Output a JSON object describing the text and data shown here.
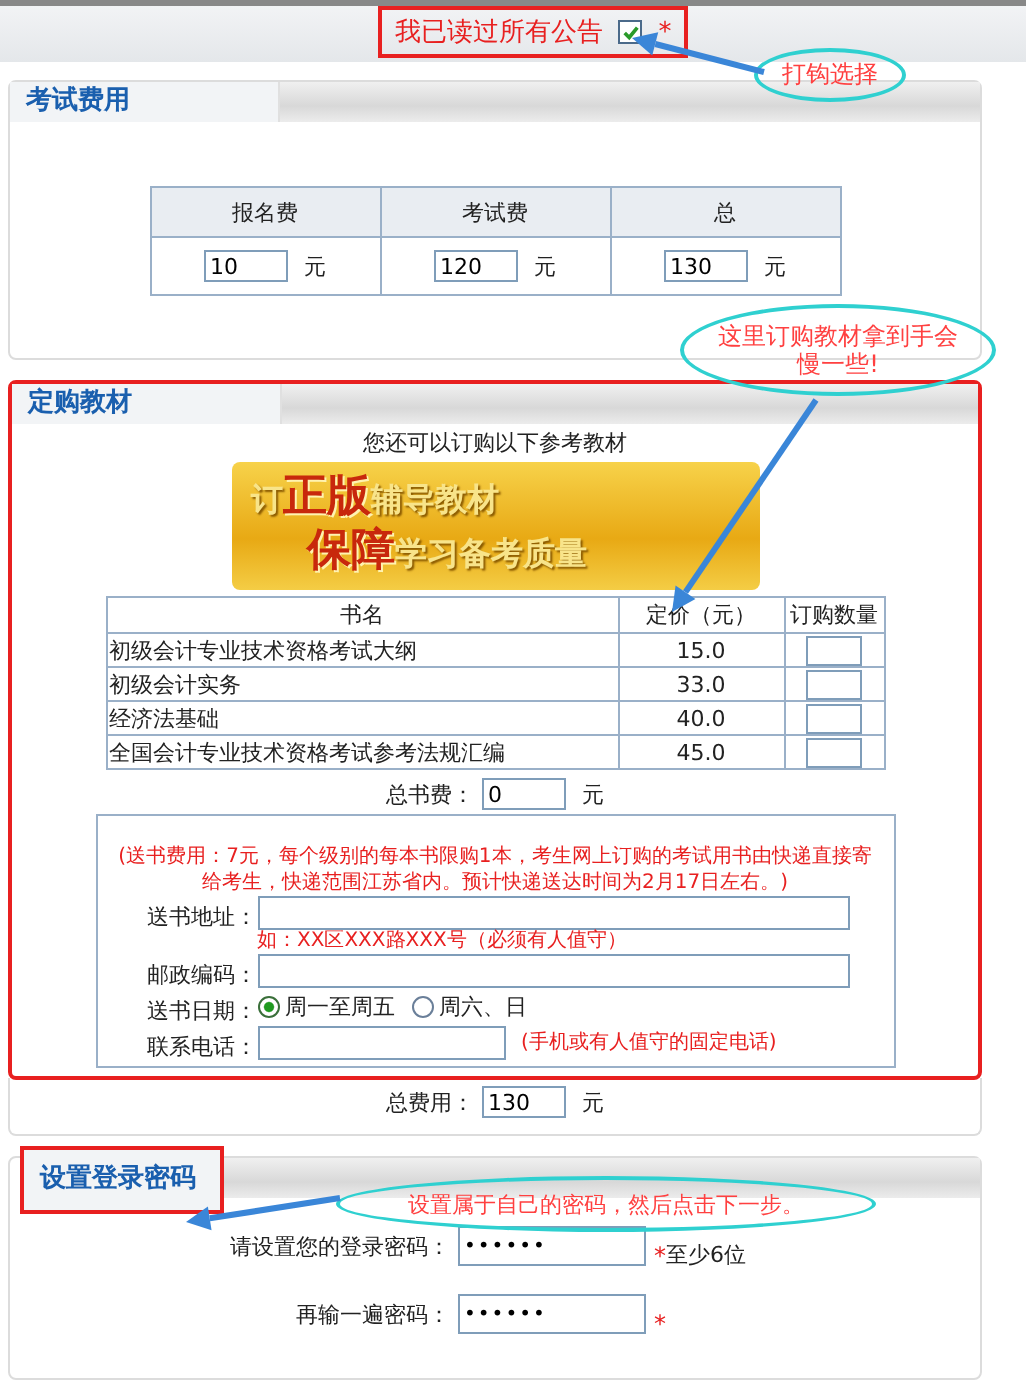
{
  "notice": {
    "text": "我已读过所有公告",
    "checked": true,
    "required_mark": "*"
  },
  "exam_fees": {
    "title": "考试费用",
    "columns": [
      "报名费",
      "考试费",
      "总"
    ],
    "values": [
      {
        "value": "10",
        "unit": "元"
      },
      {
        "value": "120",
        "unit": "元"
      },
      {
        "value": "130",
        "unit": "元"
      }
    ]
  },
  "textbooks": {
    "title": "定购教材",
    "intro": "您还可以订购以下参考教材",
    "banner": [
      [
        {
          "text": "订",
          "emph": false
        },
        {
          "text": "正版",
          "emph": true
        },
        {
          "text": "辅导教材",
          "emph": false
        }
      ],
      [
        {
          "text": "保障",
          "emph": true
        },
        {
          "text": "学习备考质量",
          "emph": false
        }
      ]
    ],
    "columns": [
      "书名",
      "定价（元）",
      "订购数量"
    ],
    "rows": [
      {
        "name": "初级会计专业技术资格考试大纲",
        "price": "15.0"
      },
      {
        "name": "初级会计实务",
        "price": "33.0"
      },
      {
        "name": "经济法基础",
        "price": "40.0"
      },
      {
        "name": "全国会计专业技术资格考试参考法规汇编",
        "price": "45.0"
      }
    ],
    "total": {
      "label": "总书费：",
      "value": "0",
      "unit": "元"
    },
    "shipping": {
      "note": "(送书费用：7元，每个级别的每本书限购1本，考生网上订购的考试用书由快递直接寄给考生，快递范围江苏省内。预计快递送达时间为2月17日左右。)",
      "fields": [
        {
          "kind": "text",
          "label": "送书地址：",
          "hint": "如：XX区XXX路XXX号（必须有人值守）"
        },
        {
          "kind": "text",
          "label": "邮政编码："
        },
        {
          "kind": "radio",
          "label": "送书日期：",
          "options": [
            {
              "label": "周一至周五",
              "selected": true
            },
            {
              "label": "周六、日",
              "selected": false
            }
          ]
        },
        {
          "kind": "short",
          "label": "联系电话：",
          "hint": "(手机或有人值守的固定电话)"
        }
      ]
    }
  },
  "grand_total": {
    "label": "总费用：",
    "value": "130",
    "unit": "元"
  },
  "password": {
    "title": "设置登录密码",
    "fields": [
      {
        "label": "请设置您的登录密码：",
        "value": "••••••",
        "required_mark": "*",
        "note": "至少6位"
      },
      {
        "label": "再输一遍密码：",
        "value": "••••••",
        "required_mark": "*"
      }
    ]
  },
  "annotations": [
    {
      "text": "打钩选择"
    },
    {
      "text": "这里订购教材拿到手会慢一些!"
    },
    {
      "text": "设置属于自己的密码，然后点击下一步。"
    }
  ]
}
